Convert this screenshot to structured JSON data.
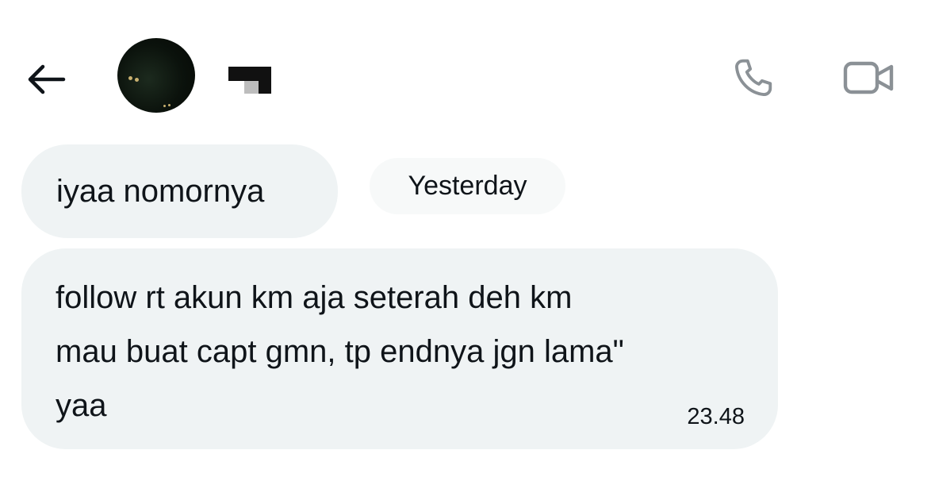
{
  "header": {
    "back_icon": "arrow-left-icon",
    "contact_name": "",
    "call_icon": "phone-icon",
    "video_icon": "video-camera-icon",
    "icon_color": "#8b9196"
  },
  "date_separator": {
    "label": "Yesterday"
  },
  "messages": [
    {
      "text": "iyaa nomornya"
    },
    {
      "text": "follow rt akun km aja seterah deh km\nmau buat capt gmn, tp endnya jgn lama\"\nyaa",
      "time": "23.48"
    }
  ],
  "colors": {
    "bubble_background": "#eff3f4",
    "page_background": "#ffffff",
    "text": "#0f1419"
  }
}
